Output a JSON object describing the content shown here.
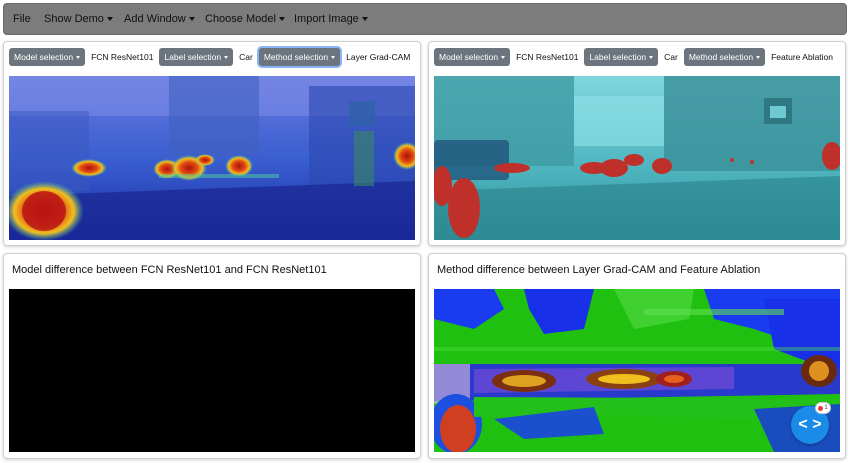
{
  "menubar": {
    "items": [
      {
        "label": "File",
        "has_caret": false
      },
      {
        "label": "Show Demo",
        "has_caret": true
      },
      {
        "label": "Add Window",
        "has_caret": true
      },
      {
        "label": "Choose Model",
        "has_caret": true
      },
      {
        "label": "Import Image",
        "has_caret": true
      }
    ]
  },
  "panels": {
    "left_top": {
      "model_btn": "Model selection",
      "model_value": "FCN ResNet101",
      "label_btn": "Label selection",
      "label_value": "Car",
      "method_btn": "Method selection",
      "method_value": "Layer Grad-CAM"
    },
    "right_top": {
      "model_btn": "Model selection",
      "model_value": "FCN ResNet101",
      "label_btn": "Label selection",
      "label_value": "Car",
      "method_btn": "Method selection",
      "method_value": "Feature Ablation"
    },
    "left_bottom": {
      "title": "Model difference between FCN ResNet101 and FCN ResNet101"
    },
    "right_bottom": {
      "title": "Method difference between Layer Grad-CAM and Feature Ablation"
    }
  },
  "fab": {
    "icon": "code-brackets-icon",
    "symbol": "< >",
    "badge_count": "1"
  },
  "colors": {
    "menubar": "#7c7c7c",
    "dropdown_button": "#6c757d",
    "focus_ring": "#8ab4f8",
    "fab": "#1a8be6"
  }
}
